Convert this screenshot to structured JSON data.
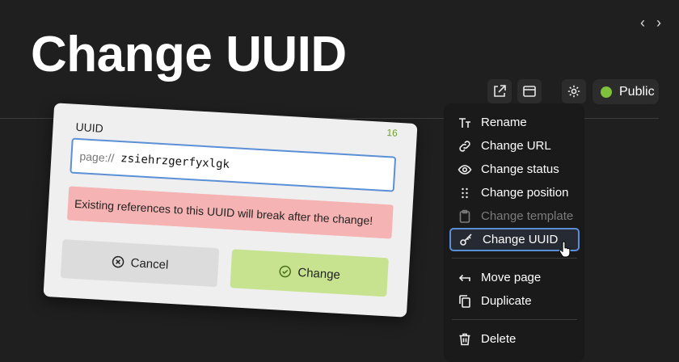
{
  "header": {
    "title": "Change UUID",
    "prev_icon": "‹",
    "next_icon": "›"
  },
  "toolbar": {
    "buttons": [
      {
        "icon": "external-link-icon"
      },
      {
        "icon": "browser-window-icon"
      },
      {
        "icon": "gear-icon"
      }
    ],
    "status": {
      "label": "Public",
      "color": "#7ec13a"
    }
  },
  "menu": {
    "items": [
      {
        "label": "Rename",
        "icon": "text-size-icon",
        "disabled": false,
        "active": false
      },
      {
        "label": "Change URL",
        "icon": "link-icon",
        "disabled": false,
        "active": false
      },
      {
        "label": "Change status",
        "icon": "eye-icon",
        "disabled": false,
        "active": false
      },
      {
        "label": "Change position",
        "icon": "drag-handle-icon",
        "disabled": false,
        "active": false
      },
      {
        "label": "Change template",
        "icon": "clipboard-icon",
        "disabled": true,
        "active": false
      },
      {
        "label": "Change UUID",
        "icon": "key-icon",
        "disabled": false,
        "active": true
      },
      {
        "label": "Move page",
        "icon": "arrow-left-icon",
        "disabled": false,
        "active": false
      },
      {
        "label": "Duplicate",
        "icon": "copy-icon",
        "disabled": false,
        "active": false
      },
      {
        "label": "Delete",
        "icon": "trash-icon",
        "disabled": false,
        "active": false
      }
    ]
  },
  "dialog": {
    "label": "UUID",
    "prefix": "page://",
    "value": "zsiehrzgerfyxlgk",
    "char_count": "16",
    "warning": "Existing references to this UUID will break after the change!",
    "cancel_label": "Cancel",
    "change_label": "Change"
  }
}
